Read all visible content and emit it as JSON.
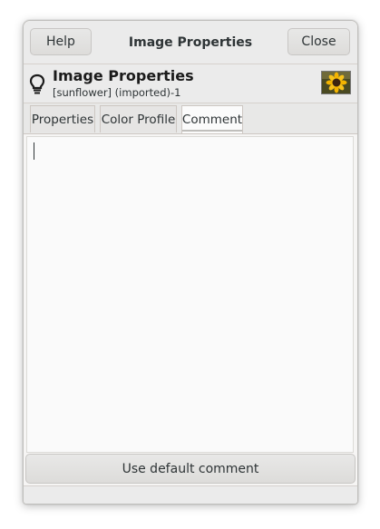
{
  "header_bar": {
    "help_label": "Help",
    "title": "Image Properties",
    "close_label": "Close"
  },
  "dialog_header": {
    "icon": "lightbulb-icon",
    "title": "Image Properties",
    "subtitle": "[sunflower] (imported)-1",
    "thumbnail": "sunflower-thumbnail"
  },
  "tabs": [
    {
      "label": "Properties",
      "active": false
    },
    {
      "label": "Color Profile",
      "active": false
    },
    {
      "label": "Comment",
      "active": true
    }
  ],
  "comment": {
    "value": ""
  },
  "footer": {
    "default_label": "Use default comment"
  },
  "colors": {
    "window_bg": "#f6f5f4",
    "header_bg": "#ebebeb",
    "text": "#2e3436",
    "active_tab_bg": "#fbfbfb"
  }
}
